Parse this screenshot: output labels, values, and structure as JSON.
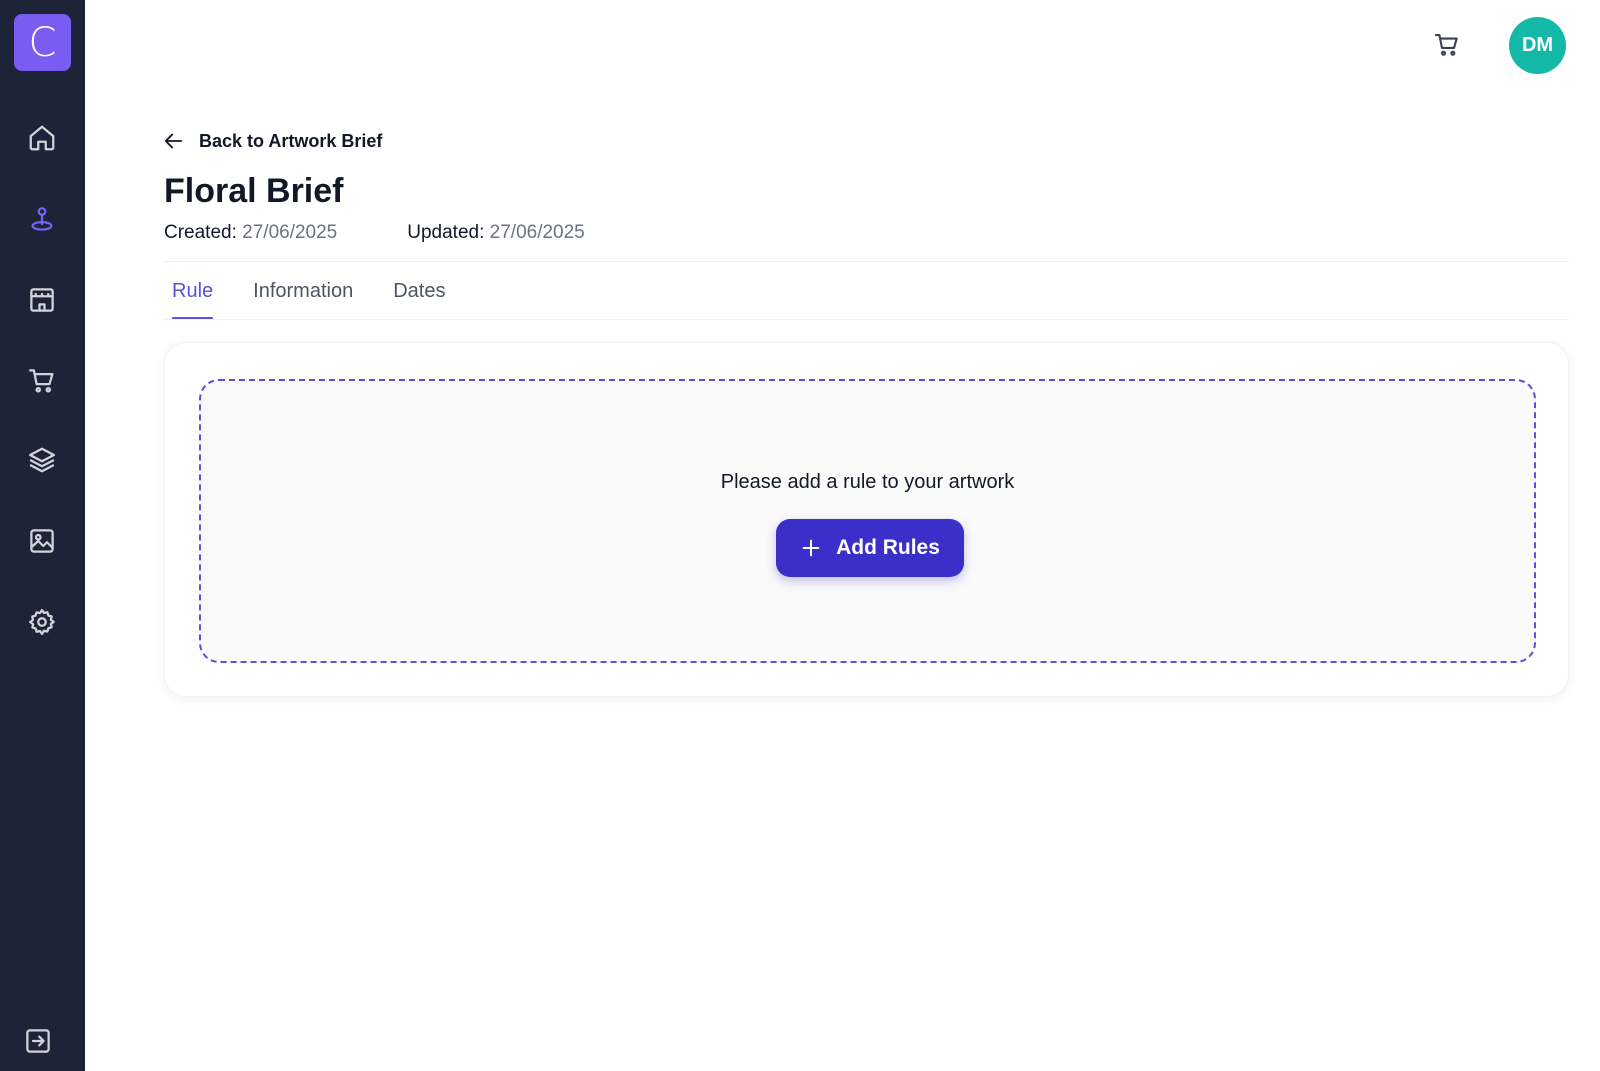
{
  "sidebar": {
    "logo_letter": "C",
    "items": [
      {
        "name": "home",
        "icon": "home-icon",
        "active": false
      },
      {
        "name": "artwork-briefs",
        "icon": "pin-location-icon",
        "active": true
      },
      {
        "name": "store",
        "icon": "store-icon",
        "active": false
      },
      {
        "name": "cart",
        "icon": "cart-icon",
        "active": false
      },
      {
        "name": "layers",
        "icon": "layers-icon",
        "active": false
      },
      {
        "name": "gallery",
        "icon": "image-icon",
        "active": false
      },
      {
        "name": "settings",
        "icon": "gear-icon",
        "active": false
      }
    ],
    "logout_icon": "logout-icon"
  },
  "header": {
    "cart_icon": "cart-icon",
    "avatar_initials": "DM"
  },
  "page": {
    "back_label": "Back to Artwork Brief",
    "title": "Floral Brief",
    "created_label": "Created:",
    "created_value": "27/06/2025",
    "updated_label": "Updated:",
    "updated_value": "27/06/2025"
  },
  "tabs": [
    {
      "label": "Rule",
      "active": true
    },
    {
      "label": "Information",
      "active": false
    },
    {
      "label": "Dates",
      "active": false
    }
  ],
  "rules_panel": {
    "empty_message": "Please add a rule to your artwork",
    "add_button_label": "Add Rules"
  },
  "colors": {
    "sidebar_bg": "#1e2437",
    "logo_bg": "#7a5cf2",
    "accent": "#5b51d8",
    "button_bg": "#3b2fc9",
    "avatar_bg": "#14b8a6"
  }
}
